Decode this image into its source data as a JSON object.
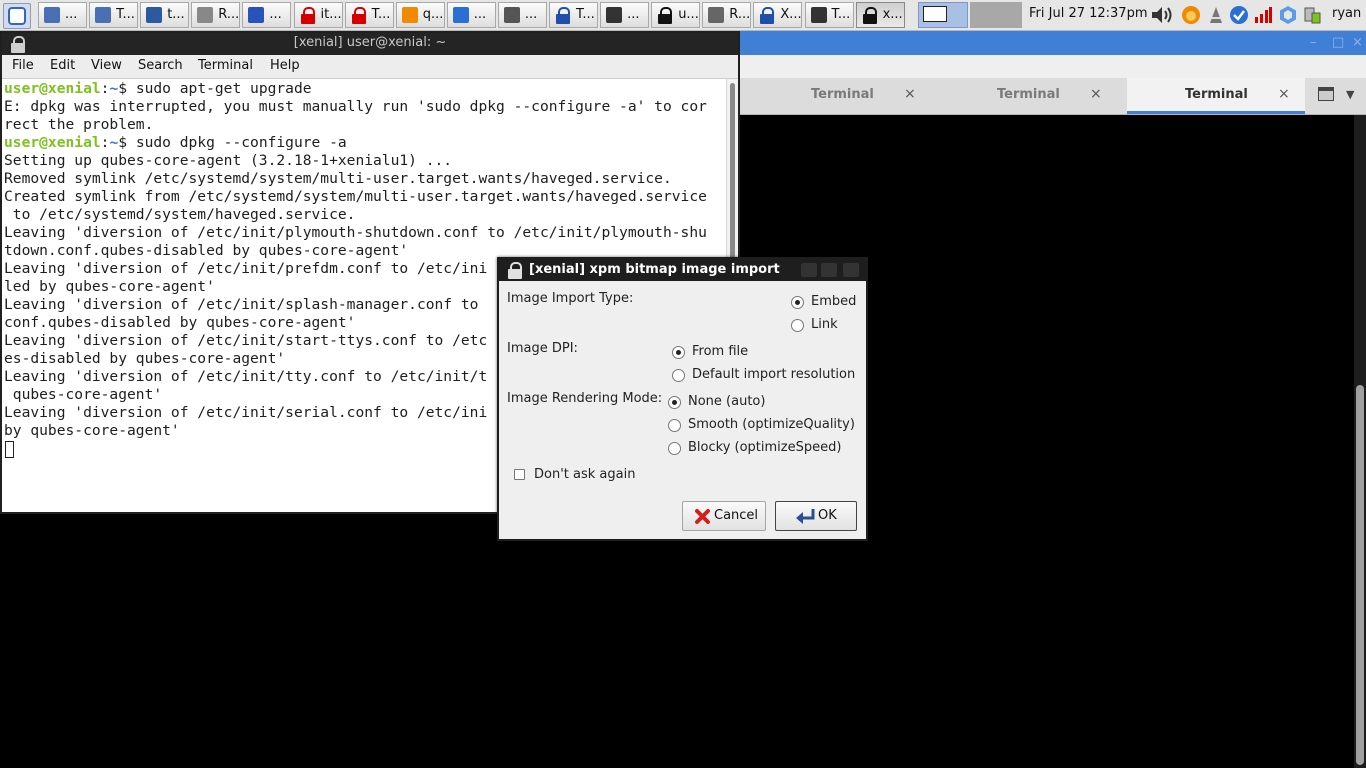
{
  "panel": {
    "tasks": [
      {
        "label": "...",
        "icon": "pen-icon",
        "color": "#4a6fb5"
      },
      {
        "label": "T...",
        "icon": "pen-icon",
        "color": "#4a6fb5"
      },
      {
        "label": "t...",
        "icon": "document-icon",
        "color": "#2c5aa0"
      },
      {
        "label": "R...",
        "icon": "document-icon",
        "color": "#888888"
      },
      {
        "label": "...",
        "icon": "firefox-icon",
        "color": "#2a52be"
      },
      {
        "label": "it...",
        "icon": "lock-icon",
        "color": "#d40000"
      },
      {
        "label": "T...",
        "icon": "lock-icon",
        "color": "#d40000"
      },
      {
        "label": "q...",
        "icon": "smiley-icon",
        "color": "#f08a00"
      },
      {
        "label": "...",
        "icon": "search-icon",
        "color": "#2a6fd6"
      },
      {
        "label": "...",
        "icon": "disk-icon",
        "color": "#555555"
      },
      {
        "label": "T...",
        "icon": "lock-icon",
        "color": "#1f4fa8"
      },
      {
        "label": "...",
        "icon": "terminal-icon",
        "color": "#333333"
      },
      {
        "label": "u...",
        "icon": "lock-icon",
        "color": "#111111"
      },
      {
        "label": "R...",
        "icon": "cone-icon",
        "color": "#666666"
      },
      {
        "label": "X...",
        "icon": "lock-icon",
        "color": "#1f4fa8"
      },
      {
        "label": "T...",
        "icon": "terminal-icon",
        "color": "#333333"
      },
      {
        "label": "x...",
        "icon": "lock-icon",
        "color": "#111111"
      }
    ],
    "clock": "Fri Jul 27 12:37pm",
    "user": "ryan"
  },
  "background_window": {
    "tabs": [
      {
        "label": "Terminal",
        "active": false
      },
      {
        "label": "Terminal",
        "active": false
      },
      {
        "label": "Terminal",
        "active": true
      }
    ],
    "tab_close": "×"
  },
  "terminal": {
    "title": "[xenial] user@xenial: ~",
    "menu": [
      "File",
      "Edit",
      "View",
      "Search",
      "Terminal",
      "Help"
    ],
    "prompt_user": "user@xenial",
    "prompt_sep": ":",
    "prompt_path": "~",
    "lines": [
      {
        "prompt": true,
        "text": "$ sudo apt-get upgrade"
      },
      {
        "prompt": false,
        "text": "E: dpkg was interrupted, you must manually run 'sudo dpkg --configure -a' to cor"
      },
      {
        "prompt": false,
        "text": "rect the problem."
      },
      {
        "prompt": true,
        "text": "$ sudo dpkg --configure -a"
      },
      {
        "prompt": false,
        "text": "Setting up qubes-core-agent (3.2.18-1+xenialu1) ..."
      },
      {
        "prompt": false,
        "text": "Removed symlink /etc/systemd/system/multi-user.target.wants/haveged.service."
      },
      {
        "prompt": false,
        "text": "Created symlink from /etc/systemd/system/multi-user.target.wants/haveged.service"
      },
      {
        "prompt": false,
        "text": " to /etc/systemd/system/haveged.service."
      },
      {
        "prompt": false,
        "text": "Leaving 'diversion of /etc/init/plymouth-shutdown.conf to /etc/init/plymouth-shu"
      },
      {
        "prompt": false,
        "text": "tdown.conf.qubes-disabled by qubes-core-agent'"
      },
      {
        "prompt": false,
        "text": "Leaving 'diversion of /etc/init/prefdm.conf to /etc/ini"
      },
      {
        "prompt": false,
        "text": "led by qubes-core-agent'"
      },
      {
        "prompt": false,
        "text": "Leaving 'diversion of /etc/init/splash-manager.conf to"
      },
      {
        "prompt": false,
        "text": "conf.qubes-disabled by qubes-core-agent'"
      },
      {
        "prompt": false,
        "text": "Leaving 'diversion of /etc/init/start-ttys.conf to /etc"
      },
      {
        "prompt": false,
        "text": "es-disabled by qubes-core-agent'"
      },
      {
        "prompt": false,
        "text": "Leaving 'diversion of /etc/init/tty.conf to /etc/init/t"
      },
      {
        "prompt": false,
        "text": " qubes-core-agent'"
      },
      {
        "prompt": false,
        "text": "Leaving 'diversion of /etc/init/serial.conf to /etc/ini"
      },
      {
        "prompt": false,
        "text": "by qubes-core-agent'"
      }
    ]
  },
  "dialog": {
    "title": "[xenial] xpm bitmap image import",
    "import_type_label": "Image Import Type:",
    "import_type_options": [
      {
        "label": "Embed",
        "selected": true
      },
      {
        "label": "Link",
        "selected": false
      }
    ],
    "dpi_label": "Image DPI:",
    "dpi_options": [
      {
        "label": "From file",
        "selected": true
      },
      {
        "label": "Default import resolution",
        "selected": false
      }
    ],
    "rendering_label": "Image Rendering Mode:",
    "rendering_options": [
      {
        "label": "None (auto)",
        "selected": true
      },
      {
        "label": "Smooth (optimizeQuality)",
        "selected": false
      },
      {
        "label": "Blocky (optimizeSpeed)",
        "selected": false
      }
    ],
    "dont_ask_label": "Don't ask again",
    "dont_ask_checked": false,
    "cancel_label": "Cancel",
    "ok_label": "OK"
  },
  "colors": {
    "accent": "#3f80d6",
    "prompt_user": "#7ec21e",
    "prompt_path": "#3a6fd8"
  }
}
